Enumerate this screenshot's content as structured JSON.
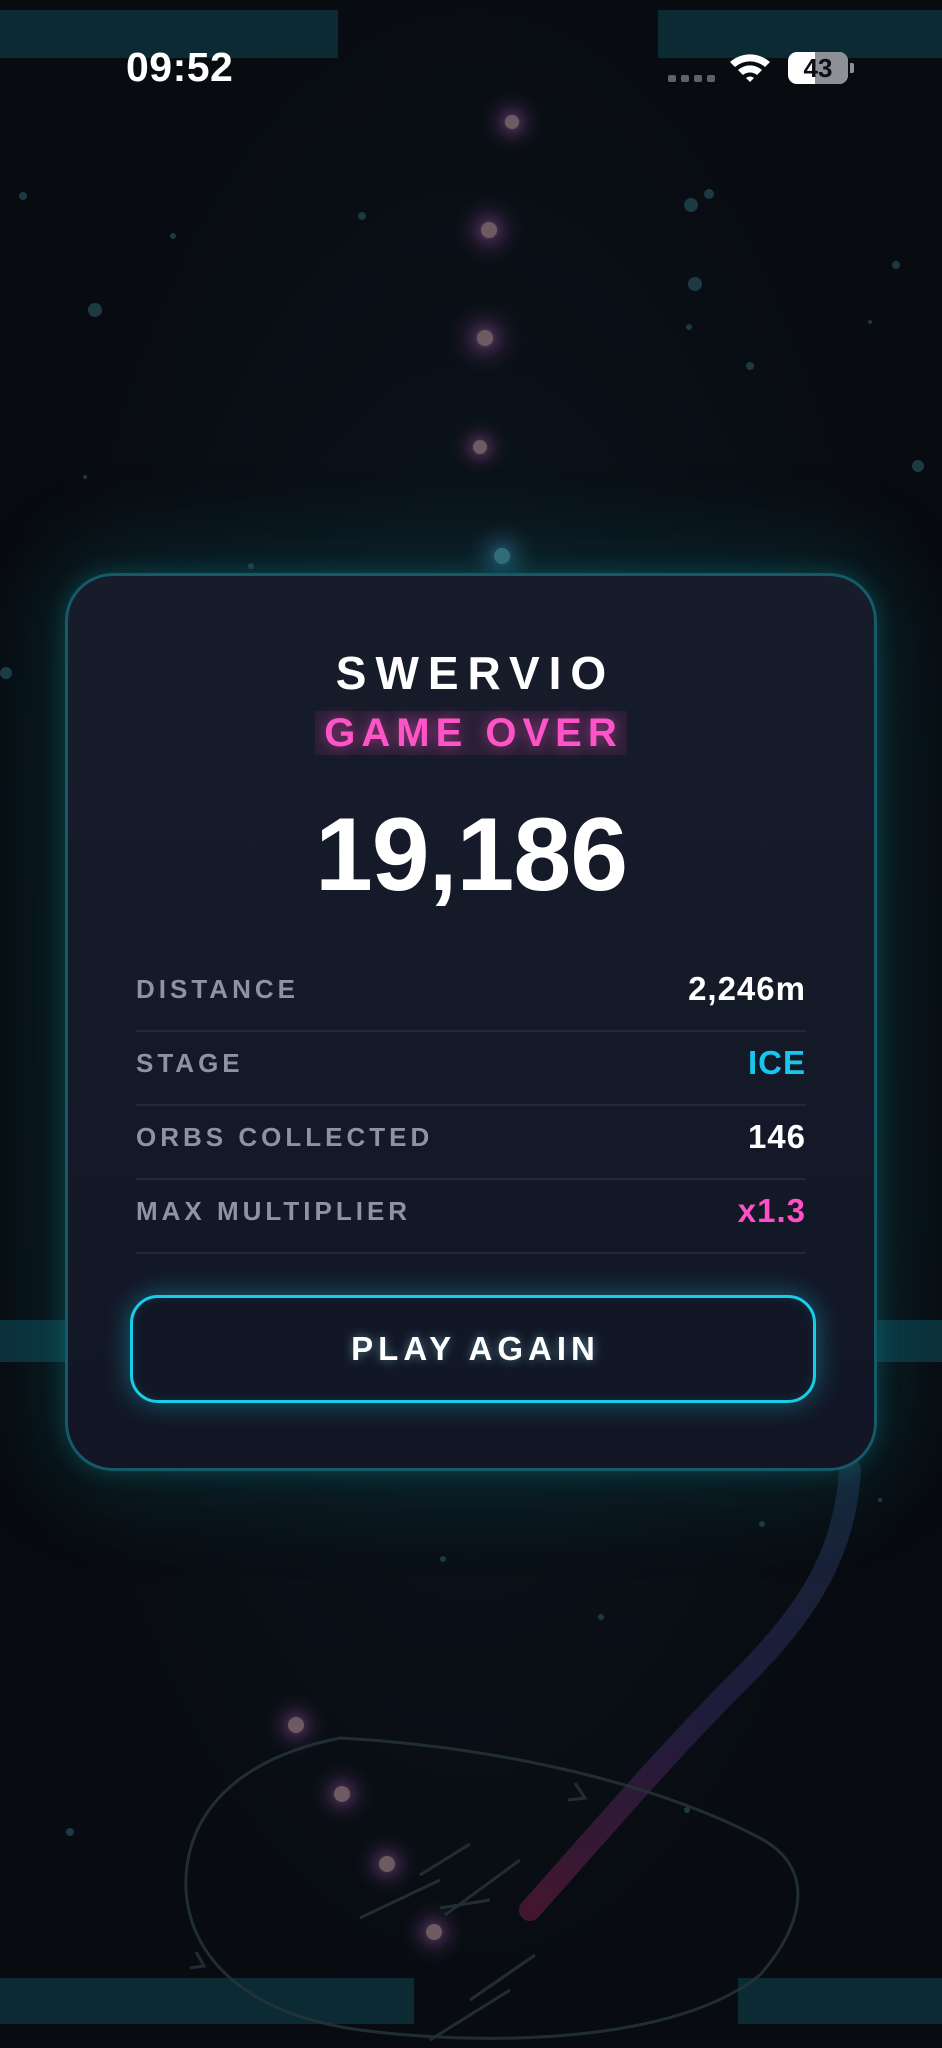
{
  "status_bar": {
    "time": "09:52",
    "battery_level": "43",
    "signal_icon": "cellular-signal-icon",
    "wifi_icon": "wifi-icon",
    "battery_icon": "battery-icon"
  },
  "game_over": {
    "title": "SWERVIO",
    "subtitle": "GAME OVER",
    "score": "19,186",
    "stats": [
      {
        "label": "DISTANCE",
        "value": "2,246m"
      },
      {
        "label": "STAGE",
        "value": "ICE"
      },
      {
        "label": "ORBS COLLECTED",
        "value": "146"
      },
      {
        "label": "MAX MULTIPLIER",
        "value": "x1.3"
      }
    ],
    "play_again_label": "PLAY AGAIN"
  },
  "colors": {
    "background": "#090d13",
    "card_border": "#145a68",
    "accent_cyan": "#17cde8",
    "accent_pink": "#ff54c8",
    "stat_label": "#8e93a3"
  }
}
